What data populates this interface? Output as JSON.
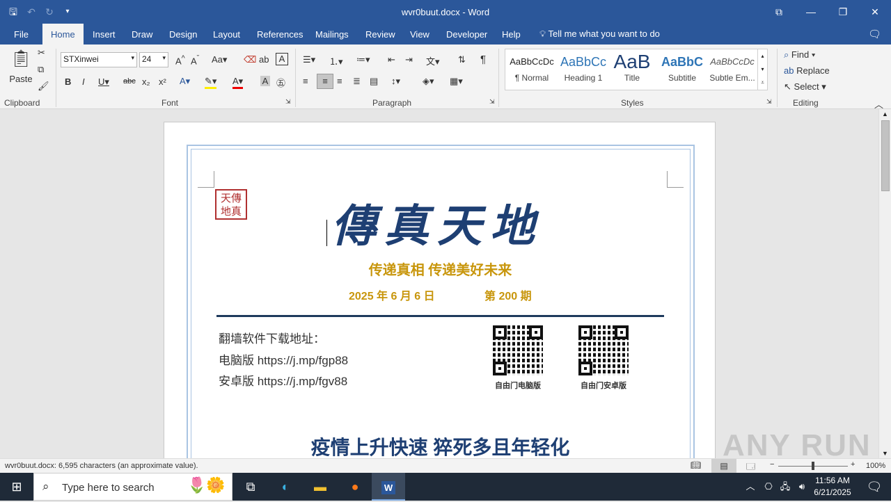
{
  "window": {
    "title": "wvr0buut.docx - Word"
  },
  "tabs": [
    "File",
    "Home",
    "Insert",
    "Draw",
    "Design",
    "Layout",
    "References",
    "Mailings",
    "Review",
    "View",
    "Developer",
    "Help"
  ],
  "active_tab": "Home",
  "tell_me": "Tell me what you want to do",
  "clipboard": {
    "paste": "Paste",
    "label": "Clipboard"
  },
  "font": {
    "name": "STXinwei",
    "size": "24",
    "label": "Font"
  },
  "paragraph": {
    "label": "Paragraph"
  },
  "styles": {
    "label": "Styles",
    "items": [
      {
        "preview": "AaBbCcDc",
        "name": "¶ Normal"
      },
      {
        "preview": "AaBbCc",
        "name": "Heading 1"
      },
      {
        "preview": "AaB",
        "name": "Title"
      },
      {
        "preview": "AaBbC",
        "name": "Subtitle"
      },
      {
        "preview": "AaBbCcDc",
        "name": "Subtle Em..."
      }
    ]
  },
  "editing": {
    "find": "Find",
    "replace": "Replace",
    "select": "Select",
    "label": "Editing"
  },
  "document": {
    "seal_text": "天傳地真",
    "masthead": "傳真天地",
    "slogan": "传递真相  传递美好未来",
    "date": "2025 年 6 月 6 日",
    "issue": "第 200 期",
    "download_title": "翻墙软件下载地址：",
    "pc_line": "电脑版 https://j.mp/fgp88",
    "android_line": "安卓版 https://j.mp/fgv88",
    "qr1_label": "自由门电脑版",
    "qr2_label": "自由门安卓版",
    "headline": "疫情上升快速  猝死多且年轻化"
  },
  "status": {
    "text": "wvr0buut.docx: 6,595 characters (an approximate value).",
    "zoom": "100%"
  },
  "taskbar": {
    "search_placeholder": "Type here to search",
    "time": "11:56 AM",
    "date": "6/21/2025"
  },
  "watermark": "ANY RUN"
}
